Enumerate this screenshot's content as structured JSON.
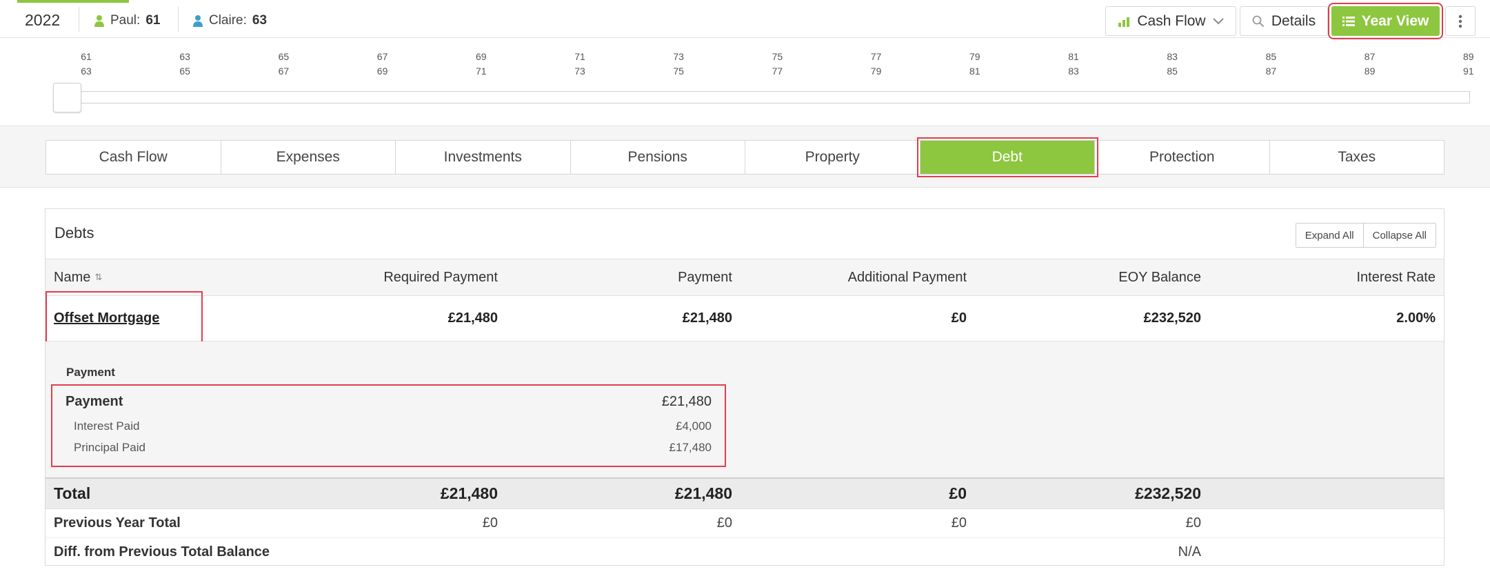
{
  "header": {
    "year": "2022",
    "persons": [
      {
        "name": "Paul:",
        "age": "61",
        "color": "#8dc63f"
      },
      {
        "name": "Claire:",
        "age": "63",
        "color": "#3aa0c8"
      }
    ],
    "buttons": {
      "cash_flow": "Cash Flow",
      "details": "Details",
      "year_view": "Year View"
    }
  },
  "timeline": {
    "paul_ages": [
      "61",
      "63",
      "65",
      "67",
      "69",
      "71",
      "73",
      "75",
      "77",
      "79",
      "81",
      "83",
      "85",
      "87",
      "89"
    ],
    "claire_ages": [
      "63",
      "65",
      "67",
      "69",
      "71",
      "73",
      "75",
      "77",
      "79",
      "81",
      "83",
      "85",
      "87",
      "89",
      "91"
    ]
  },
  "tabs": [
    "Cash Flow",
    "Expenses",
    "Investments",
    "Pensions",
    "Property",
    "Debt",
    "Protection",
    "Taxes"
  ],
  "active_tab": "Debt",
  "debts": {
    "title": "Debts",
    "expand_all": "Expand All",
    "collapse_all": "Collapse All",
    "columns": {
      "name": "Name",
      "required_payment": "Required Payment",
      "payment": "Payment",
      "additional_payment": "Additional Payment",
      "eoy_balance": "EOY Balance",
      "interest_rate": "Interest Rate"
    },
    "row": {
      "name": "Offset Mortgage",
      "required_payment": "£21,480",
      "payment": "£21,480",
      "additional_payment": "£0",
      "eoy_balance": "£232,520",
      "interest_rate": "2.00%"
    },
    "detail": {
      "section_title": "Payment",
      "payment_label": "Payment",
      "payment_value": "£21,480",
      "interest_label": "Interest Paid",
      "interest_value": "£4,000",
      "principal_label": "Principal Paid",
      "principal_value": "£17,480"
    },
    "total": {
      "label": "Total",
      "required_payment": "£21,480",
      "payment": "£21,480",
      "additional_payment": "£0",
      "eoy_balance": "£232,520"
    },
    "previous_year": {
      "label": "Previous Year Total",
      "required_payment": "£0",
      "payment": "£0",
      "additional_payment": "£0",
      "eoy_balance": "£0"
    },
    "diff": {
      "label": "Diff. from Previous Total Balance",
      "eoy_balance": "N/A"
    }
  },
  "colors": {
    "accent": "#8dc63f",
    "highlight": "#e23d4b"
  }
}
